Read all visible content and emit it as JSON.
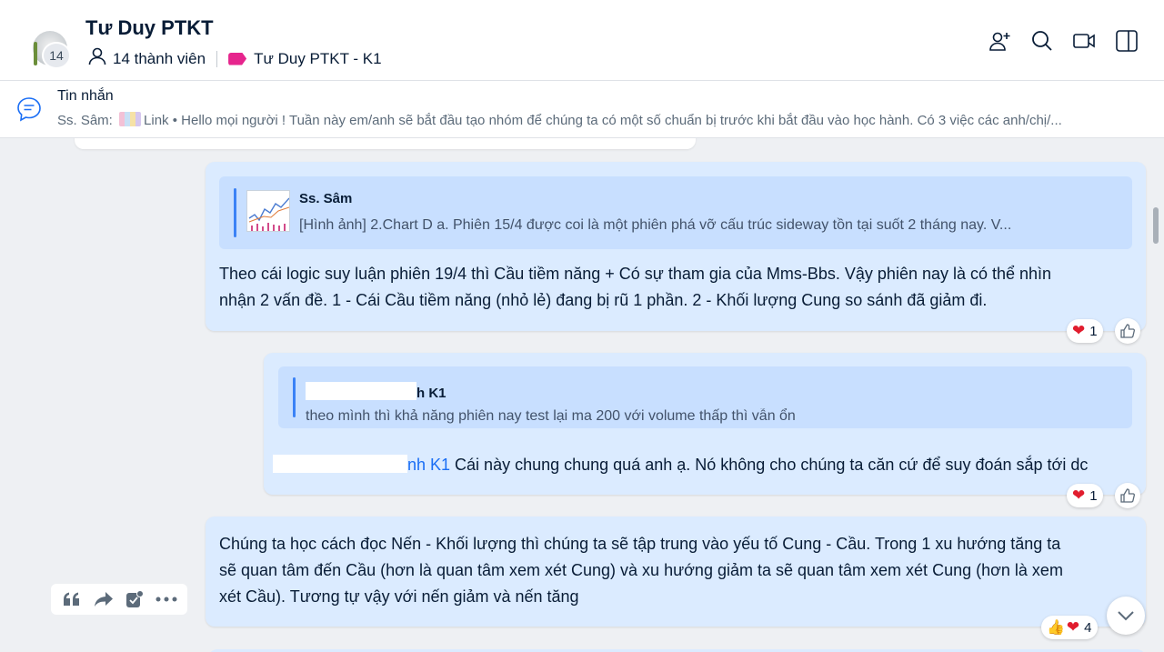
{
  "header": {
    "group_name": "Tư Duy PTKT",
    "avatar_count": "14",
    "members_label": "14 thành viên",
    "tag_label": "Tư Duy PTKT - K1",
    "icons": [
      "add-member-icon",
      "search-icon",
      "video-call-icon",
      "sidebar-toggle-icon"
    ]
  },
  "pinned": {
    "title": "Tin nhắn",
    "sender": "Ss. Sâm:",
    "link_label": "Link",
    "text": "Hello mọi người ! Tuần này em/anh sẽ bắt đầu tạo nhóm để chúng ta có một số chuẩn bị trước khi bắt đầu vào học hành. Có 3 việc các anh/chị/..."
  },
  "messages": [
    {
      "quote_name": "Ss. Sâm",
      "quote_text": "[Hình ảnh] 2.Chart D a. Phiên 15/4 được coi là một phiên phá vỡ cấu trúc sideway tồn tại suốt 2 tháng nay. V...",
      "line1": "Theo cái logic suy luận phiên 19/4 thì Cầu tiềm năng + Có sự tham gia của Mms-Bbs. Vậy phiên nay là có thể nhìn",
      "line2": "nhận 2 vấn đề. 1 - Cái Cầu tiềm năng (nhỏ lẻ) đang bị rũ 1 phần. 2 - Khối lượng Cung so sánh đã giảm đi.",
      "reaction_count": "1"
    },
    {
      "quote_name_suffix": "h K1",
      "quote_text": "theo mình thì khả năng phiên nay test lại ma 200 với volume thấp thì vẫn ổn",
      "mention_suffix": "nh K1",
      "text": " Cái này chung chung quá anh ạ. Nó không cho chúng ta căn cứ để suy đoán sắp tới dc",
      "reaction_count": "1"
    },
    {
      "line1": "Chúng ta học cách đọc Nến - Khối lượng thì chúng ta sẽ tập trung vào yếu tố Cung - Cầu. Trong 1 xu hướng tăng ta",
      "line2": "sẽ quan tâm đến Cầu (hơn là quan tâm xem xét Cung) và xu hướng giảm ta sẽ quan tâm xem xét Cung (hơn là xem",
      "line3": "xét Cầu). Tương tự vậy với nến giảm và nến tăng",
      "reaction_count": "4"
    }
  ],
  "colors": {
    "bubble": "#dbebff",
    "quote": "#c8dfff",
    "accent": "#1a6ef5",
    "tag": "#e6258d",
    "heart": "#e11d2e"
  }
}
